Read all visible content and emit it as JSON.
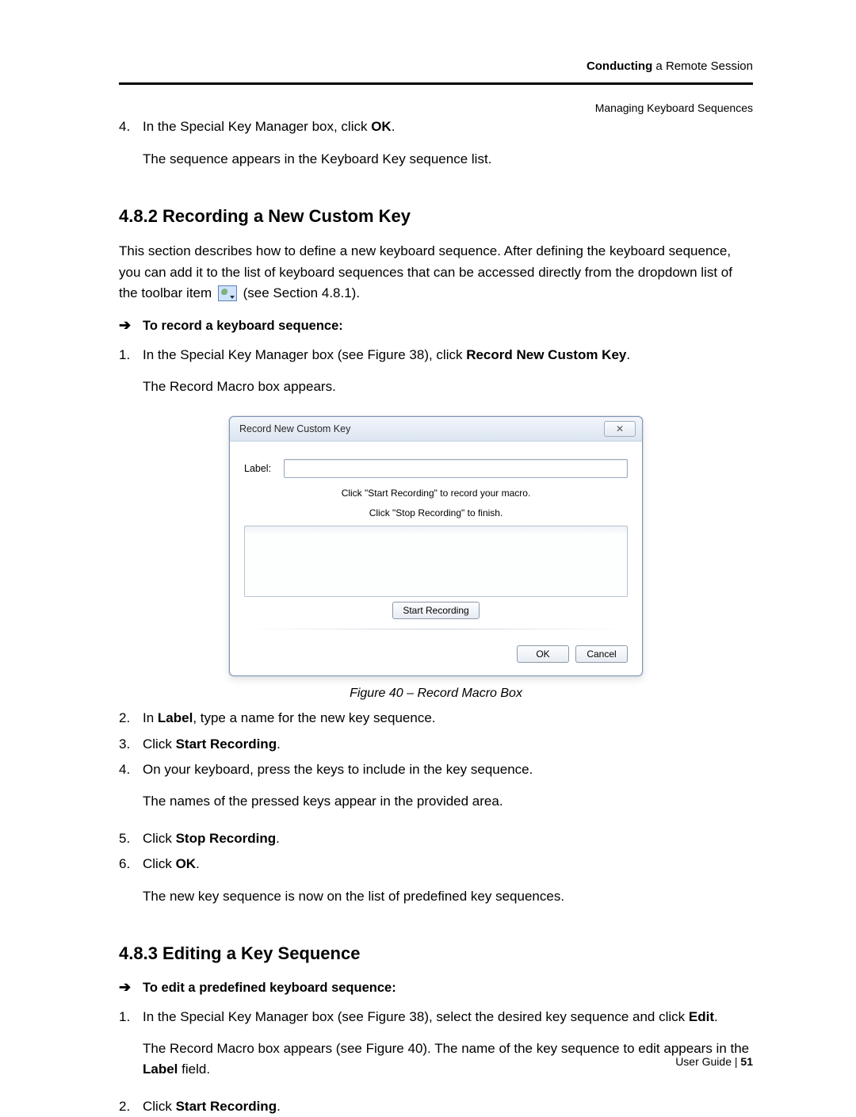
{
  "header": {
    "line1_bold": "Conducting",
    "line1_rest": " a Remote Session",
    "line2": "Managing Keyboard Sequences"
  },
  "intro_step4": {
    "num": "4.",
    "pre": "In the Special Key Manager box, click ",
    "bold": "OK",
    "post": ".",
    "sub": "The sequence appears in the Keyboard Key sequence list."
  },
  "h482": "4.8.2   Recording a New Custom Key",
  "para482a_pre": "This section describes how to define a new keyboard sequence. After defining the keyboard sequence, you can add it to the list of keyboard sequences that can be accessed directly from the dropdown list of the toolbar item ",
  "para482a_post": " (see Section 4.8.1).",
  "proc1": "To record a keyboard sequence:",
  "step1": {
    "num": "1.",
    "pre": "In the Special Key Manager box (see Figure 38), click ",
    "bold": "Record New Custom Key",
    "post": ".",
    "sub": "The Record Macro box appears."
  },
  "dialog": {
    "title": "Record New Custom Key",
    "close_glyph": "✕",
    "label_text": "Label:",
    "hint1": "Click \"Start Recording\" to record your macro.",
    "hint2": "Click \"Stop Recording\" to finish.",
    "start_btn": "Start Recording",
    "ok_btn": "OK",
    "cancel_btn": "Cancel"
  },
  "fig_caption": "Figure 40 – Record Macro Box",
  "step2": {
    "num": "2.",
    "pre": "In ",
    "b": "Label",
    "post": ", type a name for the new key sequence."
  },
  "step3": {
    "num": "3.",
    "pre": "Click ",
    "b": "Start Recording",
    "post": "."
  },
  "step4b": {
    "num": "4.",
    "txt": "On your keyboard, press the keys to include in the key sequence.",
    "sub": "The names of the pressed keys appear in the provided area."
  },
  "step5": {
    "num": "5.",
    "pre": "Click ",
    "b": "Stop Recording",
    "post": "."
  },
  "step6": {
    "num": "6.",
    "pre": "Click ",
    "b": "OK",
    "post": ".",
    "sub": "The new key sequence is now on the list of predefined key sequences."
  },
  "h483": "4.8.3   Editing a Key Sequence",
  "proc2": "To edit a predefined keyboard sequence:",
  "e_step1": {
    "num": "1.",
    "pre": "In the Special Key Manager box (see Figure 38), select the desired key sequence and click ",
    "b": "Edit",
    "post": ".",
    "sub_pre": "The Record Macro box appears (see Figure 40). The name of the key sequence to edit appears in the ",
    "sub_b": "Label",
    "sub_post": " field."
  },
  "e_step2": {
    "num": "2.",
    "pre": "Click ",
    "b": "Start Recording",
    "post": "."
  },
  "footer": {
    "guide": "User Guide",
    "sep": " | ",
    "page": "51"
  }
}
